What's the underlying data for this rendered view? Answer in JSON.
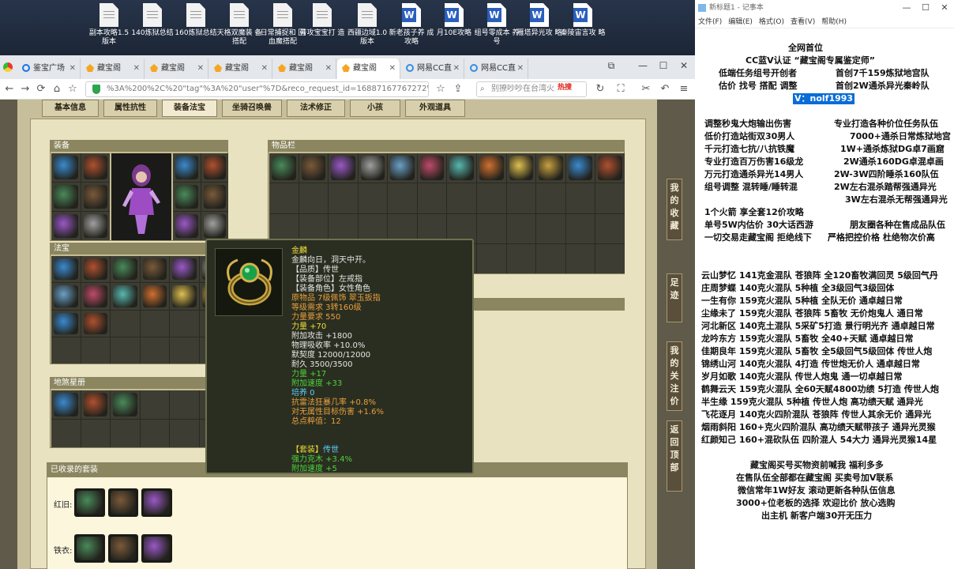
{
  "desktop": {
    "icons": [
      {
        "label": "副本攻略1.5 版本",
        "kind": "txt"
      },
      {
        "label": "140炼狱总结",
        "kind": "txt"
      },
      {
        "label": "160炼狱总结",
        "kind": "txt"
      },
      {
        "label": "天格双魔装 备搭配",
        "kind": "txt"
      },
      {
        "label": "日常捕捉和 回血魔搭配",
        "kind": "txt"
      },
      {
        "label": "普攻宝宝打 造",
        "kind": "txt"
      },
      {
        "label": "西疆边域1.0 版本",
        "kind": "txt"
      },
      {
        "label": "新老孩子养 成攻略",
        "kind": "word"
      },
      {
        "label": "月10E攻略",
        "kind": "word"
      },
      {
        "label": "组号零成本 养号",
        "kind": "word"
      },
      {
        "label": "雁塔异光攻 略",
        "kind": "word"
      },
      {
        "label": "秦陵宙言攻 略",
        "kind": "word"
      }
    ]
  },
  "browser": {
    "tabs": [
      {
        "label": "鉴宝广场",
        "icon": "search-favicon"
      },
      {
        "label": "藏宝阁",
        "icon": "taobao-favicon"
      },
      {
        "label": "藏宝阁",
        "icon": "taobao-favicon"
      },
      {
        "label": "藏宝阁",
        "icon": "taobao-favicon"
      },
      {
        "label": "藏宝阁",
        "icon": "taobao-favicon"
      },
      {
        "label": "藏宝阁",
        "icon": "taobao-favicon"
      },
      {
        "label": "网易CC直",
        "icon": "cc-favicon"
      },
      {
        "label": "网易CC直",
        "icon": "cc-favicon"
      }
    ],
    "url": "%3A%200%2C%20\"tag\"%3A%20\"user\"%7D&reco_request_id=16887167767272WJ9J",
    "search_placeholder": "别撩吵吵在台湾火",
    "hot_label": "热搜",
    "page": {
      "tabs": [
        "基本信息",
        "属性抗性",
        "装备法宝",
        "坐骑召唤兽",
        "法术修正",
        "小孩",
        "外观道具"
      ],
      "active_tab": "装备法宝",
      "sections": {
        "equip": "装备",
        "fabao": "法宝",
        "inventory": "物品栏",
        "chart": "地煞星册",
        "collected": "已收录的套装",
        "set1": "红旧:",
        "set2": "铁衣:"
      },
      "side_buttons": [
        "我的收藏",
        "足迹",
        "我的关注价",
        "返回顶部"
      ],
      "tooltip": {
        "name": "金麟",
        "desc": "金麟向日，洞天中开。",
        "lines": [
          {
            "text": "【品质】传世",
            "tone": "w"
          },
          {
            "text": "【装备部位】左戒指",
            "tone": "w"
          },
          {
            "text": "【装备角色】女性角色",
            "tone": "w"
          },
          {
            "text": "原物品 7级佩饰 翠玉扳指",
            "tone": "o"
          },
          {
            "text": "等级需求 3转160级",
            "tone": "o"
          },
          {
            "text": "力量要求 550",
            "tone": "o"
          },
          {
            "text": "力量 +70",
            "tone": "y"
          },
          {
            "text": "附加攻击 +1800",
            "tone": "w"
          },
          {
            "text": "物理吸收率 +10.0%",
            "tone": "w"
          },
          {
            "text": "默契度 12000/12000",
            "tone": "w"
          },
          {
            "text": "耐久 3500/3500",
            "tone": "w"
          },
          {
            "text": "力量 +17",
            "tone": "g"
          },
          {
            "text": "附加速度 +33",
            "tone": "g"
          },
          {
            "text": "培养 0",
            "tone": "b"
          },
          {
            "text": "抗雷法狂暴几率 +0.8%",
            "tone": "o"
          },
          {
            "text": "对无属性目标伤害 +1.6%",
            "tone": "o"
          },
          {
            "text": "总点粹值：12",
            "tone": "o"
          }
        ],
        "set_label": "【套装】",
        "set_name": "传世",
        "set_lines": [
          "强力克木 +3.4%",
          "附加速度 +5"
        ]
      }
    }
  },
  "notepad": {
    "title": "新标题1 - 记事本",
    "menu": [
      "文件(F)",
      "编辑(E)",
      "格式(O)",
      "查看(V)",
      "帮助(H)"
    ],
    "highlight": "V：nolf1993",
    "lines": [
      "全网首位",
      "CC蓝V认证 “藏宝阁专属鉴定师”",
      "低端任务组号开创者",
      "首创7千159炼狱地宫队",
      "估价 找号 搭配 调整",
      "首创2W通杀异光秦岭队",
      "调整秒鬼大炮输出伤害",
      "专业打造各种价位任务队伍",
      "低价打造站街双30男人",
      "7000+通杀日常炼狱地宫",
      "千元打造七抗/八抗铁魔",
      "1W+通杀炼狱DG卓7画窟",
      "专业打造百万伤害16级龙",
      "2W通杀160DG卓混卓画",
      "万元打造通杀异光14男人",
      "2W-3W四阶睡杀160队伍",
      "组号调整 混转睡/睡转混",
      "2W左右混杀踏帮强通异光",
      "3W左右混杀无帮强通异光",
      "1个火箭 享全套12价攻略",
      "单号5W内估价 30大话西游",
      "朋友圈各种在售成品队伍",
      "一切交易走藏宝阁 拒绝线下",
      "严格把控价格 杜绝物次价高",
      "云山梦忆 141克金混队 苍狼阵 全120畜牧满回灵 5级回气丹",
      "庄周梦蝶 140克火混队 5种植 全3级回气3级回体",
      "一生有你 159克火混队 5种植 全队无价 通卓越日常",
      "尘缘未了 159克火混队 苍狼阵 5畜牧 无价炮鬼人 通日常",
      "河北新区 140克土混队 5采矿5打造 景行明光齐 通卓越日常",
      "龙吟东方 159克火混队 5畜牧 全40+天赋 通卓越日常",
      "佳期良年 159克火混队 5畜牧 全5级回气5级回体 传世人炮",
      "锦绣山河 140克火混队 4打造 传世炮无价人 通卓越日常",
      "岁月如歌 140克火混队 传世人炮鬼 通一切卓越日常",
      "鹤舞云天 159克火混队 全60天赋4800功绩 5打造 传世人炮",
      "半生缘 159克火混队 5种植 传世人炮 高功绩天赋 通异光",
      "飞花逐月 140克火四阶混队 苍狼阵 传世人其余无价 通异光",
      "烟雨斜阳 160+克火四阶混队 高功绩天赋带孩子 通异光灵猴",
      "红颜知己 160+混砍队伍 四阶混人 54大力 通异光灵猴14星",
      "藏宝阁买号买物资前喊我 福利多多",
      "在售队伍全部都在藏宝阁 买卖号加V联系",
      "微信常年1W好友 滚动更新各种队伍信息",
      "3000+位老板的选择 欢迎比价 放心选购",
      "出主机 新客户端30开无压力"
    ]
  }
}
